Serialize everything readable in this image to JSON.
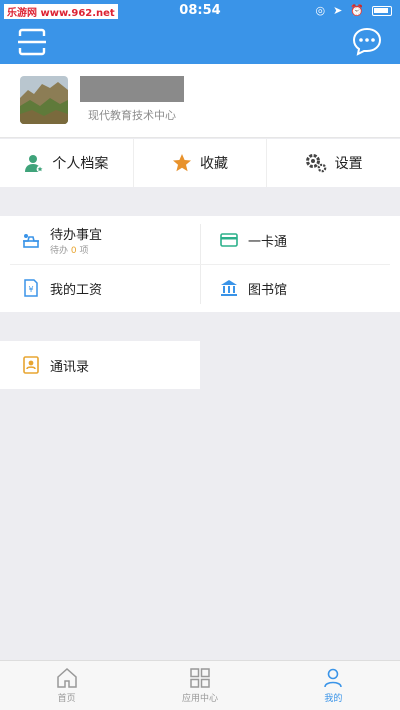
{
  "status": {
    "carrier": "乐游网 www.962.net",
    "time": "08:54"
  },
  "profile": {
    "org": "现代教育技术中心"
  },
  "quick": [
    {
      "label": "个人档案",
      "icon": "profile-icon"
    },
    {
      "label": "收藏",
      "icon": "star-icon"
    },
    {
      "label": "设置",
      "icon": "gear-icon"
    }
  ],
  "grid": {
    "todo": {
      "label": "待办事宜",
      "sub_prefix": "待办",
      "count": "0",
      "sub_suffix": "项"
    },
    "card": {
      "label": "一卡通"
    },
    "salary": {
      "label": "我的工资"
    },
    "library": {
      "label": "图书馆"
    }
  },
  "contacts": {
    "label": "通讯录"
  },
  "tabs": [
    {
      "label": "首页",
      "icon": "home-icon"
    },
    {
      "label": "应用中心",
      "icon": "apps-icon"
    },
    {
      "label": "我的",
      "icon": "me-icon",
      "active": true
    }
  ],
  "colors": {
    "primary": "#3a94e8",
    "accent": "#e8a531"
  }
}
